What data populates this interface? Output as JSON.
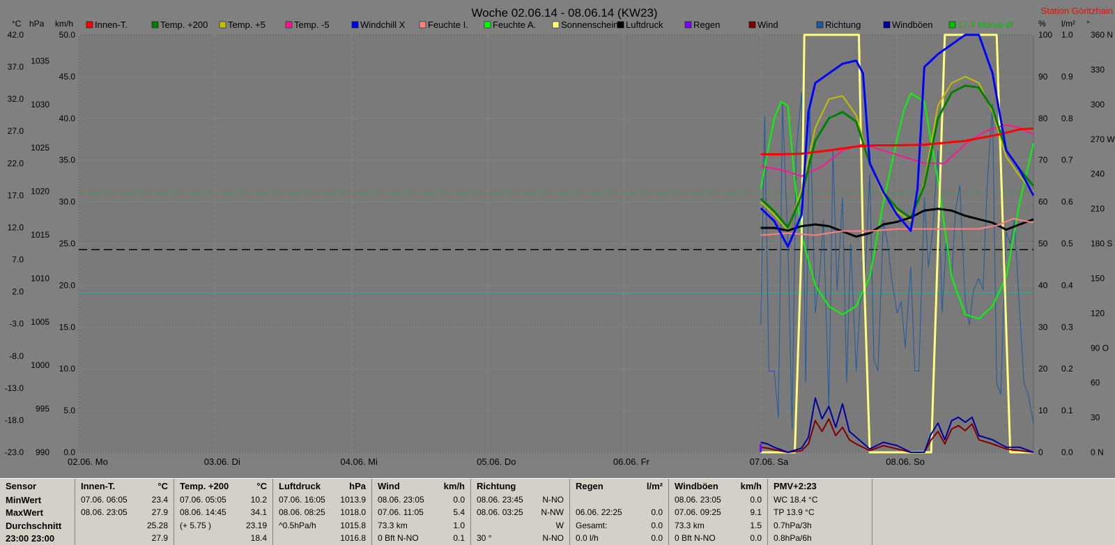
{
  "colors": {
    "background": "#808080",
    "plot": "#7a7a7a",
    "grid": "#8c8c8c",
    "panel": "#d4d0c8"
  },
  "chart_data": {
    "type": "line",
    "title": "Woche 02.06.14 - 08.06.14 (KW23)",
    "station": "Station Göritzhain",
    "x_ticks": [
      "02.06. Mo",
      "03.06. Di",
      "04.06. Mi",
      "05.06. Do",
      "06.06. Fr",
      "07.06. Sa",
      "08.06. So"
    ],
    "axis_units": [
      "°C",
      "hPa",
      "km/h",
      "%",
      "l/m²",
      "°"
    ],
    "axes": {
      "temp_c": {
        "ticks": [
          "42.0",
          "37.0",
          "32.0",
          "27.0",
          "22.0",
          "17.0",
          "12.0",
          "7.0",
          "2.0",
          "-3.0",
          "-8.0",
          "-13.0",
          "-18.0",
          "-23.0"
        ],
        "ylim": [
          -23,
          42
        ]
      },
      "pressure_hpa": {
        "ticks": [
          "1035",
          "1030",
          "1025",
          "1020",
          "1015",
          "1010",
          "1005",
          "1000",
          "995",
          "990"
        ],
        "ylim": [
          990,
          1038
        ]
      },
      "wind_kmh": {
        "ticks": [
          "50.0",
          "45.0",
          "40.0",
          "35.0",
          "30.0",
          "25.0",
          "20.0",
          "15.0",
          "10.0",
          "5.0",
          "0.0"
        ],
        "ylim": [
          0,
          50
        ]
      },
      "humidity_pct": {
        "ticks": [
          "100",
          "90",
          "80",
          "70",
          "60",
          "50",
          "40",
          "30",
          "20",
          "10",
          "0"
        ],
        "ylim": [
          0,
          100
        ]
      },
      "rain_lm2": {
        "ticks": [
          "1.0",
          "0.9",
          "0.8",
          "0.7",
          "0.6",
          "0.5",
          "0.4",
          "0.3",
          "0.2",
          "0.1",
          "0.0"
        ],
        "ylim": [
          0,
          1
        ]
      },
      "direction_deg": {
        "ticks": [
          "360 N",
          "330",
          "300",
          "270 W",
          "240",
          "210",
          "180 S",
          "150",
          "120",
          "90 O",
          "60",
          "30",
          "0 N"
        ],
        "ylim": [
          0,
          360
        ]
      }
    },
    "legend": [
      {
        "name": "Innen-T.",
        "color": "#ff0000"
      },
      {
        "name": "Temp. +200",
        "color": "#008000"
      },
      {
        "name": "Temp. +5",
        "color": "#c0c000"
      },
      {
        "name": "Temp. -5",
        "color": "#ff1493"
      },
      {
        "name": "Windchill X",
        "color": "#0000ff"
      },
      {
        "name": "Feuchte I.",
        "color": "#ff8080"
      },
      {
        "name": "Feuchte A.",
        "color": "#00ff00"
      },
      {
        "name": "Sonnenschein",
        "color": "#ffff80"
      },
      {
        "name": "Luftdruck",
        "color": "#000000"
      },
      {
        "name": "Regen",
        "color": "#8000ff"
      },
      {
        "name": "Wind",
        "color": "#800000"
      },
      {
        "name": "Richtung",
        "color": "#1e5aa0"
      },
      {
        "name": "Windböen",
        "color": "#0000a0"
      },
      {
        "name": "17.4 Monat-Ø",
        "color": "#00c000"
      }
    ],
    "x_range_days": [
      0,
      7
    ],
    "reference_lines": [
      {
        "axis": "temp_c",
        "value": 17.4,
        "color": "#3a9a3a",
        "style": "dash"
      },
      {
        "axis": "temp_c",
        "value": 1.8,
        "color": "#40a0a0",
        "style": "solid"
      },
      {
        "axis": "pressure_hpa",
        "value": 1013.3,
        "color": "#000000",
        "style": "dash"
      }
    ],
    "series": [
      {
        "name": "Innen-T.",
        "axis": "temp_c",
        "color": "#ff0000",
        "width": 3,
        "x": [
          5.0,
          5.15,
          5.3,
          5.5,
          5.7,
          5.85,
          6.0,
          6.2,
          6.5,
          6.75,
          6.9,
          7.0
        ],
        "y": [
          23.4,
          23.4,
          23.5,
          24.0,
          24.6,
          24.8,
          24.8,
          24.9,
          25.5,
          26.5,
          27.3,
          27.4
        ]
      },
      {
        "name": "Temp. +200",
        "axis": "temp_c",
        "color": "#008000",
        "width": 3,
        "x": [
          5.0,
          5.1,
          5.2,
          5.3,
          5.4,
          5.5,
          5.6,
          5.7,
          5.8,
          5.9,
          6.0,
          6.1,
          6.2,
          6.3,
          6.4,
          6.5,
          6.6,
          6.7,
          6.8,
          6.9,
          7.0
        ],
        "y": [
          16.5,
          14.5,
          12.0,
          17.0,
          25.5,
          29.0,
          30.0,
          28.5,
          22.0,
          17.5,
          15.0,
          13.5,
          18.5,
          29.0,
          33.0,
          34.1,
          33.8,
          30.5,
          24.0,
          21.0,
          18.5
        ]
      },
      {
        "name": "Temp. +5",
        "axis": "temp_c",
        "color": "#c0c000",
        "width": 2,
        "x": [
          5.0,
          5.1,
          5.2,
          5.3,
          5.4,
          5.5,
          5.6,
          5.7,
          5.8,
          5.9,
          6.0,
          6.1,
          6.2,
          6.3,
          6.4,
          6.5,
          6.6,
          6.7,
          6.8,
          6.9,
          7.0
        ],
        "y": [
          16.0,
          14.0,
          11.5,
          18.0,
          27.5,
          32.0,
          32.5,
          29.5,
          22.0,
          17.0,
          14.5,
          13.0,
          19.0,
          31.0,
          34.5,
          35.5,
          34.5,
          30.0,
          23.0,
          20.0,
          17.5
        ]
      },
      {
        "name": "Temp. -5",
        "axis": "temp_c",
        "color": "#ff1493",
        "width": 2,
        "x": [
          5.0,
          5.15,
          5.3,
          5.45,
          5.6,
          5.75,
          5.9,
          6.05,
          6.2,
          6.35,
          6.5,
          6.65,
          6.8,
          6.9,
          7.0
        ],
        "y": [
          21.5,
          21.0,
          20.0,
          21.5,
          24.0,
          25.0,
          24.0,
          23.0,
          22.0,
          22.0,
          25.0,
          27.0,
          28.0,
          27.5,
          26.5
        ]
      },
      {
        "name": "Windchill X",
        "axis": "temp_c",
        "color": "#0000ff",
        "width": 3,
        "x": [
          5.0,
          5.1,
          5.2,
          5.3,
          5.35,
          5.4,
          5.5,
          5.6,
          5.7,
          5.75,
          5.8,
          5.9,
          6.0,
          6.1,
          6.15,
          6.2,
          6.3,
          6.4,
          6.5,
          6.6,
          6.7,
          6.8,
          6.9,
          7.0
        ],
        "y": [
          15.0,
          13.0,
          9.0,
          14.0,
          30.0,
          34.5,
          36.0,
          37.5,
          38.0,
          36.0,
          22.0,
          17.5,
          14.0,
          11.5,
          18.0,
          37.0,
          39.0,
          40.5,
          42.0,
          43.0,
          36.0,
          24.0,
          21.0,
          17.0
        ]
      },
      {
        "name": "Feuchte I.",
        "axis": "humidity_pct",
        "color": "#ff8080",
        "width": 2,
        "x": [
          5.0,
          5.2,
          5.4,
          5.6,
          5.8,
          6.0,
          6.2,
          6.4,
          6.6,
          6.75,
          6.85,
          7.0
        ],
        "y": [
          52.0,
          52.5,
          52.0,
          53.0,
          53.0,
          53.5,
          53.5,
          53.5,
          53.5,
          54.5,
          56.0,
          55.0
        ]
      },
      {
        "name": "Feuchte A.",
        "axis": "humidity_pct",
        "color": "#00ff00",
        "width": 2,
        "x": [
          5.0,
          5.05,
          5.1,
          5.15,
          5.2,
          5.25,
          5.3,
          5.4,
          5.5,
          5.6,
          5.7,
          5.8,
          5.9,
          6.0,
          6.05,
          6.1,
          6.2,
          6.3,
          6.4,
          6.5,
          6.6,
          6.7,
          6.8,
          6.9,
          7.0
        ],
        "y": [
          63.0,
          72.0,
          80.0,
          84.0,
          83.0,
          65.0,
          52.0,
          40.0,
          35.0,
          33.0,
          35.0,
          42.0,
          60.0,
          75.0,
          82.0,
          86.0,
          84.0,
          65.0,
          42.0,
          33.0,
          32.0,
          35.0,
          42.0,
          60.0,
          74.0
        ]
      },
      {
        "name": "Sonnenschein",
        "axis": "humidity_pct",
        "color": "#ffff80",
        "width": 3,
        "x": [
          5.0,
          5.25,
          5.3,
          5.32,
          5.72,
          5.75,
          5.8,
          6.25,
          6.3,
          6.35,
          6.73,
          6.78,
          6.83,
          7.0
        ],
        "y": [
          0,
          0,
          50,
          100,
          100,
          50,
          0,
          0,
          50,
          100,
          100,
          50,
          0,
          0
        ]
      },
      {
        "name": "Luftdruck",
        "axis": "pressure_hpa",
        "color": "#000000",
        "width": 3,
        "x": [
          5.0,
          5.1,
          5.2,
          5.3,
          5.4,
          5.5,
          5.6,
          5.7,
          5.8,
          5.9,
          6.0,
          6.1,
          6.2,
          6.3,
          6.4,
          6.5,
          6.6,
          6.7,
          6.8,
          6.9,
          7.0
        ],
        "y": [
          1015.8,
          1015.8,
          1015.5,
          1016.0,
          1016.2,
          1016.0,
          1015.4,
          1014.8,
          1015.2,
          1016.2,
          1016.5,
          1017.0,
          1017.8,
          1018.0,
          1017.8,
          1017.2,
          1016.8,
          1016.4,
          1015.6,
          1016.2,
          1016.8
        ]
      },
      {
        "name": "Regen",
        "axis": "rain_lm2",
        "color": "#8000ff",
        "width": 3,
        "x": [
          5.0,
          5.0
        ],
        "y": [
          0.0,
          0.02
        ]
      },
      {
        "name": "Wind",
        "axis": "wind_kmh",
        "color": "#800000",
        "width": 2,
        "x": [
          5.0,
          5.05,
          5.1,
          5.2,
          5.3,
          5.35,
          5.4,
          5.45,
          5.5,
          5.55,
          5.6,
          5.65,
          5.7,
          5.8,
          5.9,
          6.0,
          6.1,
          6.2,
          6.25,
          6.3,
          6.35,
          6.4,
          6.45,
          6.5,
          6.55,
          6.6,
          6.7,
          6.8,
          6.9,
          7.0
        ],
        "y": [
          0.6,
          0.5,
          0.3,
          0.0,
          0.2,
          1.0,
          3.8,
          2.5,
          4.0,
          2.0,
          3.0,
          1.5,
          1.0,
          0.2,
          0.8,
          0.4,
          0.0,
          0.0,
          1.5,
          2.5,
          1.0,
          2.8,
          3.2,
          2.6,
          3.4,
          1.5,
          1.0,
          0.4,
          0.2,
          0.0
        ]
      },
      {
        "name": "Richtung",
        "axis": "direction_deg",
        "color": "#1e5aa0",
        "width": 1,
        "x": [
          5.0,
          5.03,
          5.06,
          5.1,
          5.13,
          5.16,
          5.2,
          5.23,
          5.26,
          5.3,
          5.33,
          5.36,
          5.4,
          5.43,
          5.46,
          5.5,
          5.53,
          5.56,
          5.6,
          5.63,
          5.66,
          5.7,
          5.73,
          5.76,
          5.8,
          5.83,
          5.86,
          5.9,
          5.93,
          5.96,
          6.0,
          6.03,
          6.06,
          6.1,
          6.13,
          6.16,
          6.2,
          6.23,
          6.26,
          6.3,
          6.33,
          6.36,
          6.4,
          6.43,
          6.46,
          6.5,
          6.53,
          6.56,
          6.6,
          6.63,
          6.66,
          6.7,
          6.73,
          6.76,
          6.8,
          6.83,
          6.86,
          6.9,
          6.93,
          6.96,
          7.0
        ],
        "y": [
          110,
          290,
          70,
          70,
          30,
          300,
          180,
          20,
          260,
          310,
          60,
          300,
          120,
          150,
          200,
          40,
          260,
          140,
          220,
          60,
          180,
          70,
          130,
          140,
          240,
          80,
          70,
          200,
          180,
          150,
          120,
          130,
          90,
          160,
          70,
          70,
          220,
          160,
          190,
          260,
          120,
          180,
          150,
          210,
          230,
          130,
          110,
          140,
          150,
          140,
          230,
          300,
          60,
          50,
          190,
          180,
          200,
          120,
          60,
          50,
          25
        ]
      },
      {
        "name": "Windböen",
        "axis": "wind_kmh",
        "color": "#0000a0",
        "width": 2,
        "x": [
          5.0,
          5.05,
          5.1,
          5.2,
          5.3,
          5.35,
          5.4,
          5.45,
          5.5,
          5.55,
          5.6,
          5.65,
          5.7,
          5.8,
          5.9,
          6.0,
          6.1,
          6.2,
          6.25,
          6.3,
          6.35,
          6.4,
          6.45,
          6.5,
          6.55,
          6.6,
          6.7,
          6.8,
          6.9,
          7.0
        ],
        "y": [
          1.2,
          1.0,
          0.6,
          0.0,
          0.5,
          1.8,
          6.5,
          4.0,
          5.5,
          3.0,
          5.8,
          2.5,
          1.8,
          0.4,
          1.2,
          0.8,
          0.0,
          0.0,
          2.2,
          3.5,
          1.5,
          3.8,
          4.2,
          3.6,
          4.2,
          2.0,
          1.5,
          0.6,
          0.6,
          0.0
        ]
      }
    ]
  },
  "stats": {
    "columns": [
      {
        "header": "Sensor",
        "unit": "",
        "rows": [
          {
            "date": "MinWert",
            "value": ""
          },
          {
            "date": "MaxWert",
            "value": ""
          },
          {
            "date": "Durchschnitt",
            "value": ""
          },
          {
            "date": "23:00 23:00",
            "value": ""
          }
        ]
      },
      {
        "header": "Innen-T.",
        "unit": "°C",
        "rows": [
          {
            "date": "07.06.  06:05",
            "value": "23.4"
          },
          {
            "date": "08.06.  23:05",
            "value": "27.9"
          },
          {
            "date": "",
            "value": "25.28"
          },
          {
            "date": "",
            "value": "27.9"
          }
        ]
      },
      {
        "header": "Temp. +200",
        "unit": "°C",
        "rows": [
          {
            "date": "07.06.  05:05",
            "value": "10.2"
          },
          {
            "date": "08.06.  14:45",
            "value": "34.1"
          },
          {
            "date": "(+ 5.75 )",
            "value": "23.19"
          },
          {
            "date": "",
            "value": "18.4"
          }
        ]
      },
      {
        "header": "Luftdruck",
        "unit": "hPa",
        "rows": [
          {
            "date": "07.06.  16:05",
            "value": "1013.9"
          },
          {
            "date": "08.06.  08:25",
            "value": "1018.0"
          },
          {
            "date": "^0.5hPa/h",
            "value": "1015.8"
          },
          {
            "date": "",
            "value": "1016.8"
          }
        ]
      },
      {
        "header": "Wind",
        "unit": "km/h",
        "rows": [
          {
            "date": "08.06.  23:05",
            "value": "0.0"
          },
          {
            "date": "07.06.  11:05",
            "value": "5.4"
          },
          {
            "date": "73.3 km",
            "value": "1.0"
          },
          {
            "date": "0 Bft N-NO",
            "value": "0.1"
          }
        ]
      },
      {
        "header": "Richtung",
        "unit": "",
        "rows": [
          {
            "date": "08.06.  23:45",
            "value": "N-NO"
          },
          {
            "date": "08.06.  03:25",
            "value": "N-NW"
          },
          {
            "date": "",
            "value": "W"
          },
          {
            "date": "30 °",
            "value": "N-NO"
          }
        ]
      },
      {
        "header": "Regen",
        "unit": "l/m²",
        "rows": [
          {
            "date": "",
            "value": ""
          },
          {
            "date": "06.06.  22:25",
            "value": "0.0"
          },
          {
            "date": "Gesamt:",
            "value": "0.0"
          },
          {
            "date": "0.0 l/h",
            "value": "0.0"
          }
        ]
      },
      {
        "header": "Windböen",
        "unit": "km/h",
        "rows": [
          {
            "date": "08.06.  23:05",
            "value": "0.0"
          },
          {
            "date": "07.06.  09:25",
            "value": "9.1"
          },
          {
            "date": "73.3 km",
            "value": "1.5"
          },
          {
            "date": "0 Bft N-NO",
            "value": "0.0"
          }
        ]
      },
      {
        "header": "PMV+2:23",
        "unit": "",
        "rows": [
          {
            "date": "WC 18.4 °C",
            "value": ""
          },
          {
            "date": "TP 13.9 °C",
            "value": ""
          },
          {
            "date": "0.7hPa/3h",
            "value": ""
          },
          {
            "date": "0.8hPa/6h",
            "value": ""
          }
        ]
      }
    ]
  }
}
